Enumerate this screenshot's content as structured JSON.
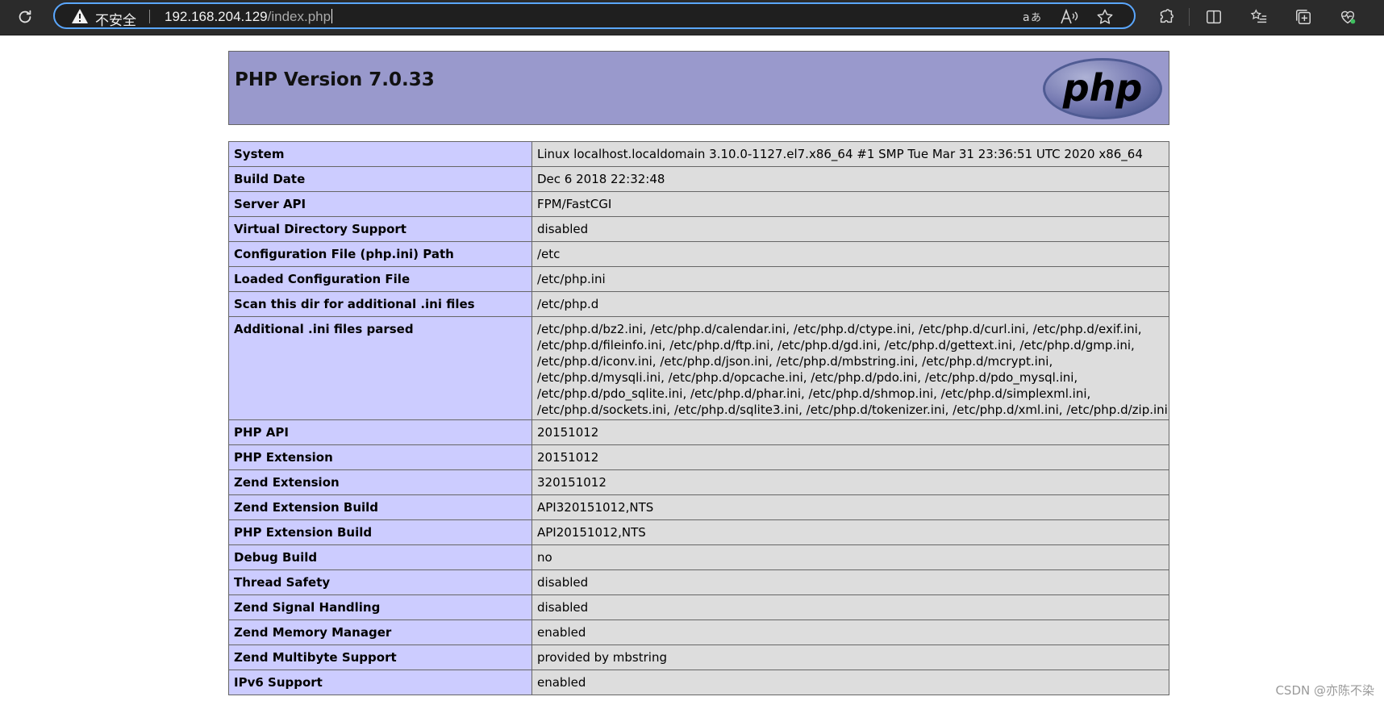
{
  "browser": {
    "security_label": "不安全",
    "url_host": "192.168.204.129",
    "url_path": "/index.php",
    "icons": [
      "reload-icon",
      "warning-icon",
      "read-aloud-translate-icon",
      "read-aloud-icon",
      "favorite-star-icon",
      "extensions-icon",
      "split-screen-icon",
      "favorites-list-icon",
      "collections-icon",
      "browser-essentials-icon"
    ]
  },
  "page": {
    "title": "PHP Version 7.0.33",
    "logo_text": "php",
    "rows": [
      {
        "key": "System",
        "value": "Linux localhost.localdomain 3.10.0-1127.el7.x86_64 #1 SMP Tue Mar 31 23:36:51 UTC 2020 x86_64"
      },
      {
        "key": "Build Date",
        "value": "Dec 6 2018 22:32:48"
      },
      {
        "key": "Server API",
        "value": "FPM/FastCGI"
      },
      {
        "key": "Virtual Directory Support",
        "value": "disabled"
      },
      {
        "key": "Configuration File (php.ini) Path",
        "value": "/etc"
      },
      {
        "key": "Loaded Configuration File",
        "value": "/etc/php.ini"
      },
      {
        "key": "Scan this dir for additional .ini files",
        "value": "/etc/php.d"
      },
      {
        "key": "Additional .ini files parsed",
        "lines": [
          "/etc/php.d/bz2.ini, /etc/php.d/calendar.ini, /etc/php.d/ctype.ini, /etc/php.d/curl.ini, /etc/php.d/exif.ini,",
          "/etc/php.d/fileinfo.ini, /etc/php.d/ftp.ini, /etc/php.d/gd.ini, /etc/php.d/gettext.ini, /etc/php.d/gmp.ini,",
          "/etc/php.d/iconv.ini, /etc/php.d/json.ini, /etc/php.d/mbstring.ini, /etc/php.d/mcrypt.ini,",
          "/etc/php.d/mysqli.ini, /etc/php.d/opcache.ini, /etc/php.d/pdo.ini, /etc/php.d/pdo_mysql.ini,",
          "/etc/php.d/pdo_sqlite.ini, /etc/php.d/phar.ini, /etc/php.d/shmop.ini, /etc/php.d/simplexml.ini,",
          "/etc/php.d/sockets.ini, /etc/php.d/sqlite3.ini, /etc/php.d/tokenizer.ini, /etc/php.d/xml.ini, /etc/php.d/zip.ini"
        ]
      },
      {
        "key": "PHP API",
        "value": "20151012"
      },
      {
        "key": "PHP Extension",
        "value": "20151012"
      },
      {
        "key": "Zend Extension",
        "value": "320151012"
      },
      {
        "key": "Zend Extension Build",
        "value": "API320151012,NTS"
      },
      {
        "key": "PHP Extension Build",
        "value": "API20151012,NTS"
      },
      {
        "key": "Debug Build",
        "value": "no"
      },
      {
        "key": "Thread Safety",
        "value": "disabled"
      },
      {
        "key": "Zend Signal Handling",
        "value": "disabled"
      },
      {
        "key": "Zend Memory Manager",
        "value": "enabled"
      },
      {
        "key": "Zend Multibyte Support",
        "value": "provided by mbstring"
      },
      {
        "key": "IPv6 Support",
        "value": "enabled"
      }
    ],
    "colors": {
      "header_bg": "#9999cc",
      "key_bg": "#ccccff",
      "value_bg": "#dddddd",
      "border": "#666666"
    }
  },
  "watermark": "CSDN @亦陈不染"
}
